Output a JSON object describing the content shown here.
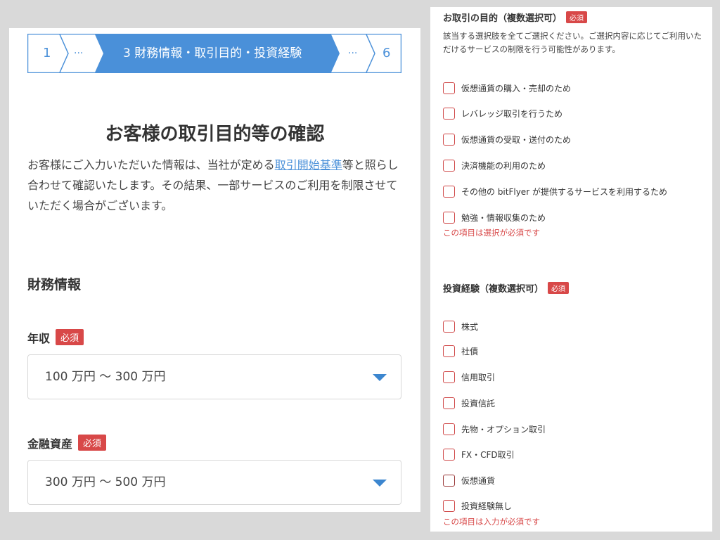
{
  "stepper": {
    "step1": "1",
    "dots1": "···",
    "current": "3 財務情報・取引目的・投資経験",
    "dots2": "···",
    "step6": "6",
    "accent": "#4a90d9"
  },
  "page": {
    "title": "お客様の取引目的等の確認",
    "intro_before": "お客様にご入力いただいた情報は、当社が定める",
    "intro_link": "取引開始基準",
    "intro_after": "等と照らし合わせて確認いたします。その結果、一部サービスのご利用を制限させていただく場合がございます。"
  },
  "financial": {
    "section_title": "財務情報",
    "required_badge": "必須",
    "income": {
      "label": "年収",
      "value": "100 万円 〜 300 万円"
    },
    "assets": {
      "label": "金融資産",
      "value": "300 万円 〜 500 万円"
    }
  },
  "purpose": {
    "title": "お取引の目的（複数選択可）",
    "required_badge": "必須",
    "description": "該当する選択肢を全てご選択ください。ご選択内容に応じてご利用いただけるサービスの制限を行う可能性があります。",
    "options": [
      "仮想通貨の購入・売却のため",
      "レバレッジ取引を行うため",
      "仮想通貨の受取・送付のため",
      "決済機能の利用のため",
      "その他の bitFlyer が提供するサービスを利用するため",
      "勉強・情報収集のため"
    ],
    "error": "この項目は選択が必須です"
  },
  "experience": {
    "title": "投資経験（複数選択可）",
    "required_badge": "必須",
    "options": [
      "株式",
      "社債",
      "信用取引",
      "投資信託",
      "先物・オプション取引",
      "FX・CFD取引",
      "仮想通貨",
      "投資経験無し"
    ],
    "error": "この項目は入力が必須です"
  },
  "colors": {
    "error_red": "#d84848",
    "select_caret": "#3c86cf"
  }
}
